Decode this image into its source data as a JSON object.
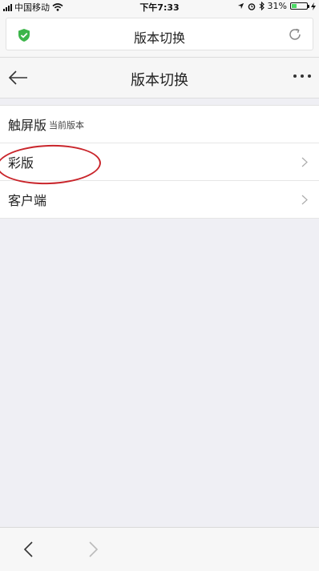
{
  "status_bar": {
    "carrier": "中国移动",
    "time": "下午7:33",
    "battery_percent": "31%",
    "battery_level": 0.31
  },
  "url_bar": {
    "title": "版本切换",
    "security_icon": "shield-check-icon",
    "reload_icon": "refresh-icon"
  },
  "page_header": {
    "title": "版本切换",
    "back_icon": "arrow-left-icon",
    "more_icon": "more-dots-icon"
  },
  "list": {
    "items": [
      {
        "label": "触屏版",
        "sub": "当前版本"
      },
      {
        "label": "彩版"
      },
      {
        "label": "客户端"
      }
    ]
  },
  "toolbar": {
    "back_icon": "chevron-left-icon",
    "forward_icon": "chevron-right-icon"
  },
  "colors": {
    "background": "#efeff4",
    "annotation": "#c9252b",
    "security": "#3cb54a",
    "battery": "#4cd964"
  }
}
